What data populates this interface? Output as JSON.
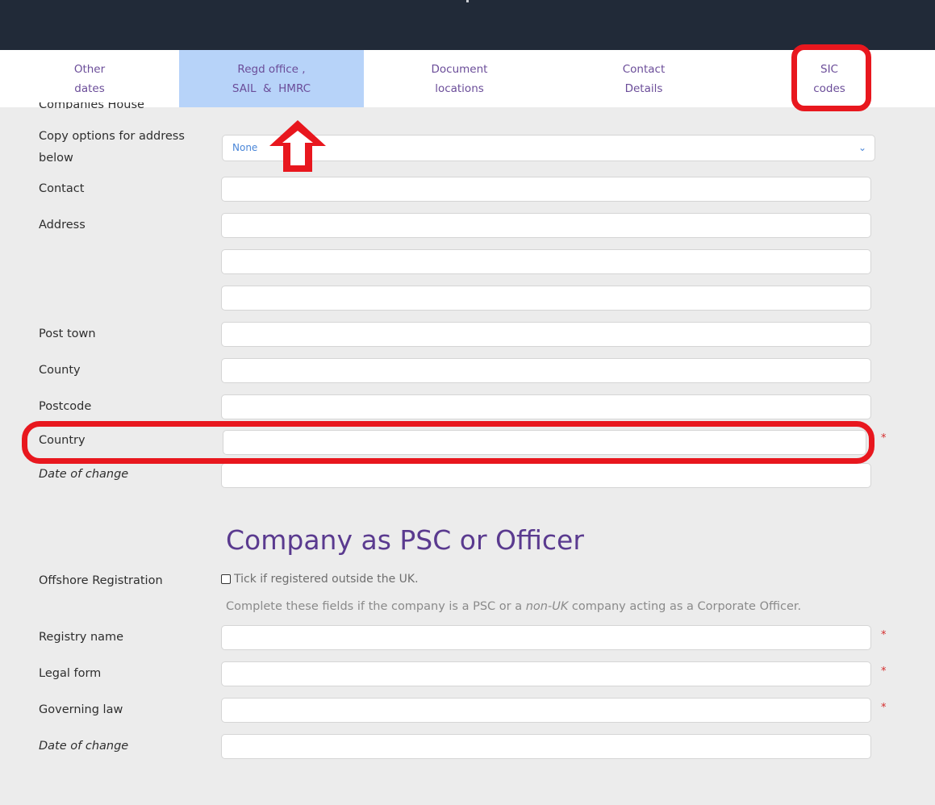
{
  "topbar": {
    "title": ""
  },
  "tabs": [
    {
      "line1": "Other",
      "line2": "dates"
    },
    {
      "line1": "Regd office ,",
      "line2": "SAIL  &  HMRC"
    },
    {
      "line1": "Document",
      "line2": "locations"
    },
    {
      "line1": "Contact",
      "line2": "Details"
    },
    {
      "line1": "SIC",
      "line2": "codes"
    }
  ],
  "address_section": {
    "cut_label": "Companies House",
    "copy_options_label": "Copy options for address below",
    "copy_options_value": "None",
    "contact_label": "Contact",
    "address_label": "Address",
    "post_town_label": "Post town",
    "county_label": "County",
    "postcode_label": "Postcode",
    "country_label": "Country",
    "date_of_change_label": "Date of change"
  },
  "psc_section": {
    "title": "Company as PSC or Officer",
    "offshore_label": "Offshore Registration",
    "offshore_checkbox_text": "Tick if registered outside the UK.",
    "hint_prefix": "Complete these fields if the company is a PSC or a ",
    "hint_emphasis": "non-UK",
    "hint_suffix": " company acting as a Corporate Officer.",
    "registry_name_label": "Registry name",
    "legal_form_label": "Legal form",
    "governing_law_label": "Governing law",
    "date_of_change_label": "Date of change"
  },
  "required_marker": "*",
  "colors": {
    "annotation": "#e8171e",
    "tab_active": "#b7d3f9",
    "heading": "#5a3a8f",
    "topbar": "#212a38"
  }
}
